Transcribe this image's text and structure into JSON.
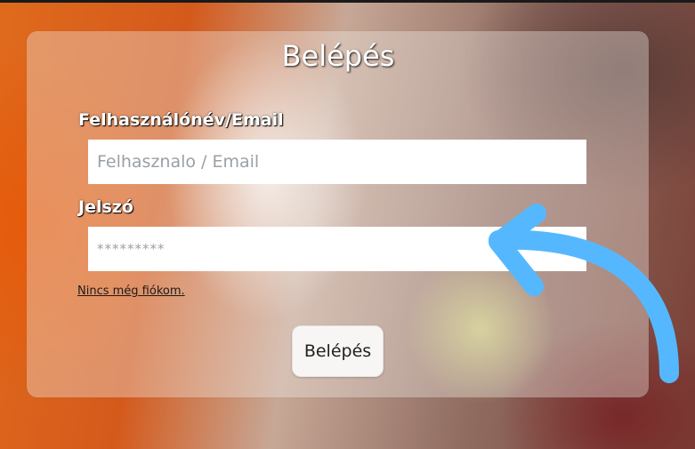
{
  "form": {
    "title": "Belépés",
    "username_label": "Felhasználónév/Email",
    "username_placeholder": "Felhasznalo / Email",
    "password_label": "Jelszó",
    "password_placeholder": "*********",
    "register_link": "Nincs még fiókom.",
    "submit_label": "Belépés"
  },
  "colors": {
    "arrow": "#55b8ff",
    "background_accent": "#e06a1c"
  },
  "icons": {
    "annotation": "curved-arrow-icon"
  }
}
